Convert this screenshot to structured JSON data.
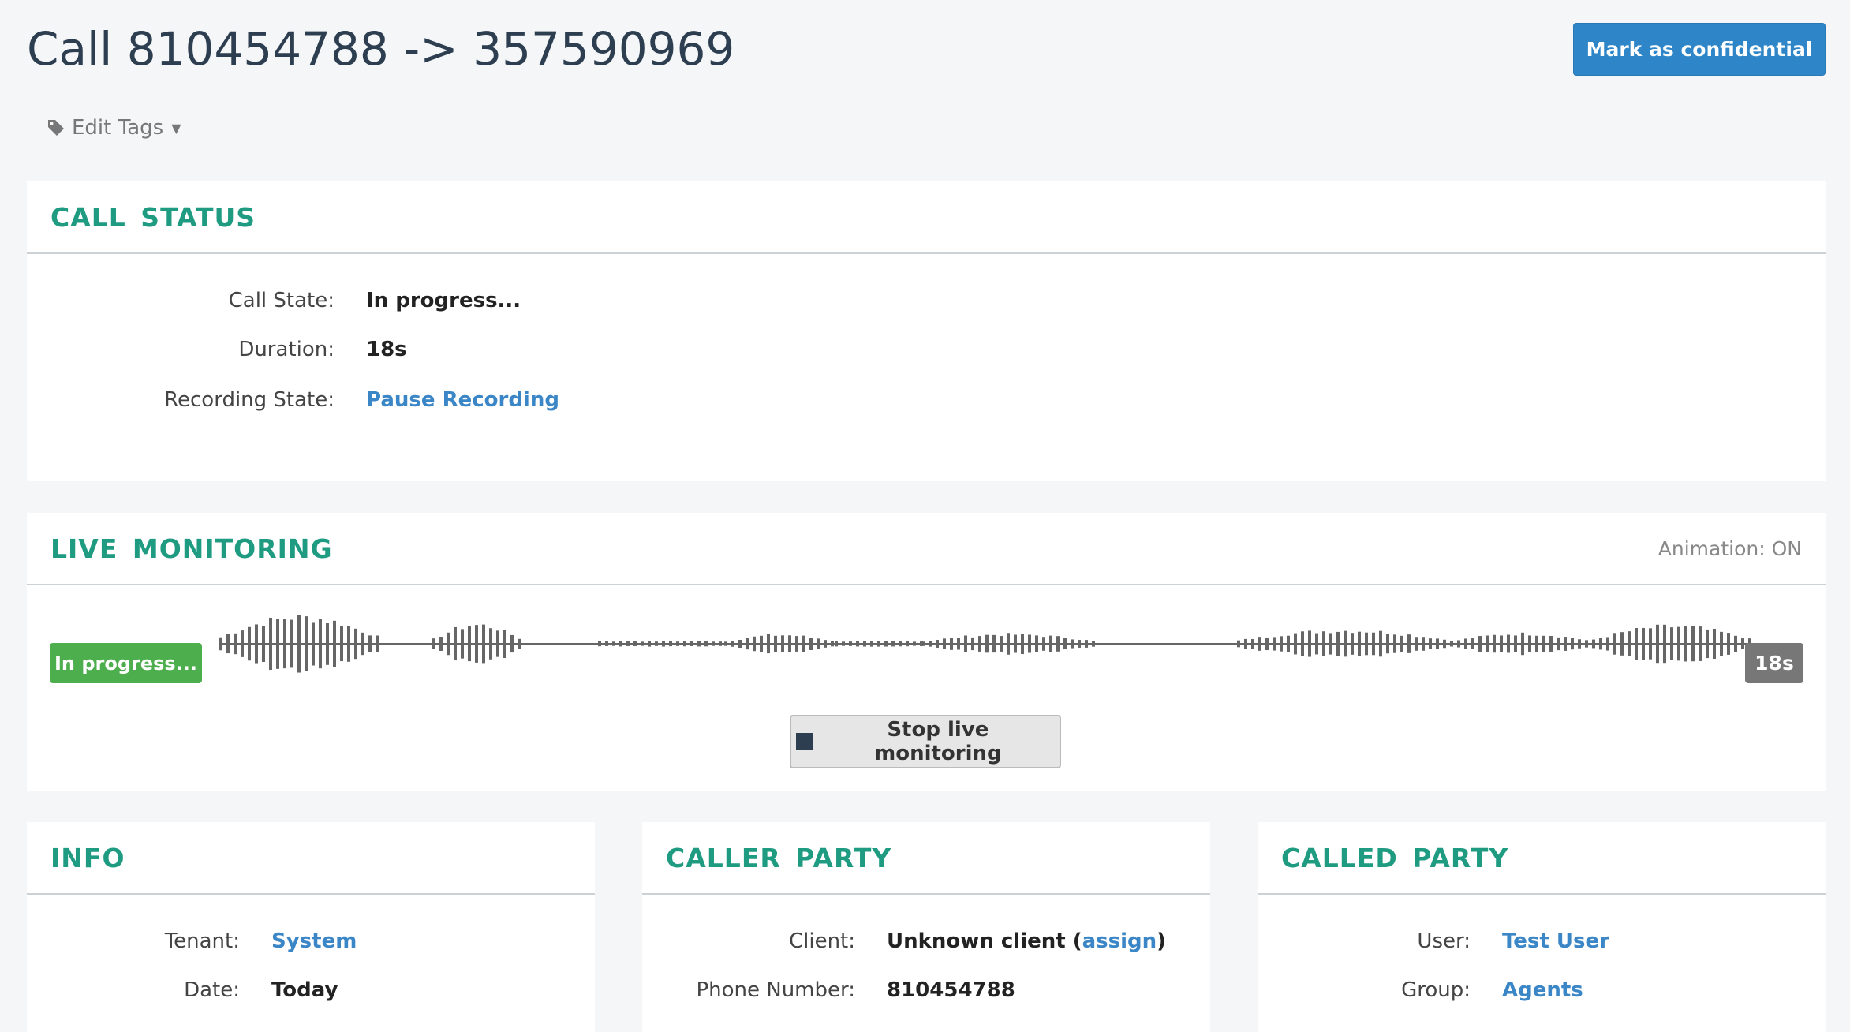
{
  "header": {
    "title": "Call 810454788 -> 357590969",
    "confidential_label": "Mark as confidential",
    "edit_tags_label": "Edit Tags"
  },
  "call_status": {
    "title": "CALL STATUS",
    "state_label": "Call State:",
    "state_value": "In progress...",
    "duration_label": "Duration:",
    "duration_value": "18s",
    "recording_label": "Recording State:",
    "recording_action": "Pause Recording"
  },
  "live_monitoring": {
    "title": "LIVE MONITORING",
    "animation_label": "Animation:",
    "animation_value": "ON",
    "progress_badge": "In progress...",
    "time_badge": "18s",
    "stop_label": "Stop live monitoring"
  },
  "info": {
    "title": "INFO",
    "tenant_label": "Tenant:",
    "tenant_value": "System",
    "date_label": "Date:",
    "date_value": "Today"
  },
  "caller_party": {
    "title": "CALLER PARTY",
    "client_label": "Client:",
    "client_value": "Unknown client (",
    "client_link": "assign",
    "client_close": ")",
    "phone_label": "Phone Number:",
    "phone_value": "810454788"
  },
  "called_party": {
    "title": "CALLED PARTY",
    "user_label": "User:",
    "user_value": "Test User",
    "group_label": "Group:",
    "group_value": "Agents"
  },
  "colors": {
    "accent": "#1f9b82",
    "link": "#3a86c6",
    "primary_button": "#2e86c8",
    "success": "#4cae4c",
    "waveform": "#666666"
  }
}
